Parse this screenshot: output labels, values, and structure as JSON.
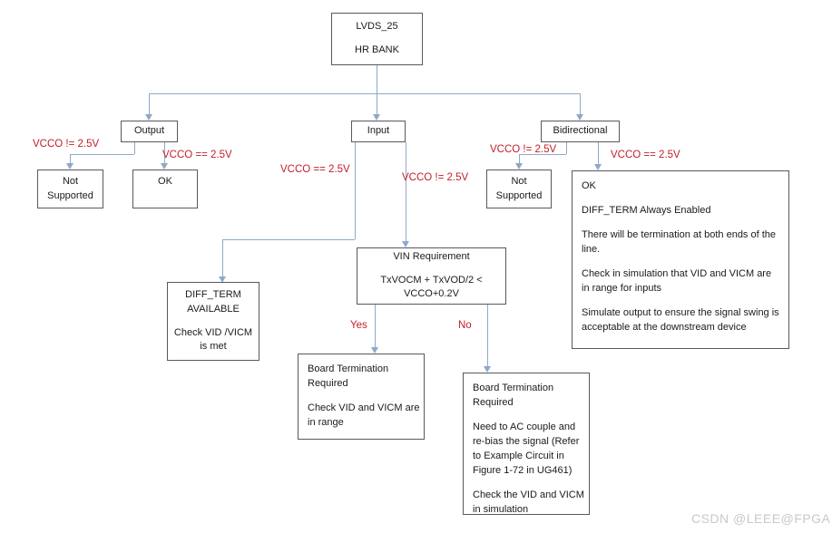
{
  "diagram": {
    "title": "LVDS_25 HR BANK termination decision flowchart",
    "colors": {
      "box_border": "#595959",
      "connector": "#8ea9c7",
      "edge_label": "#c0202a",
      "text": "#1a1a1a",
      "background": "#ffffff",
      "watermark": "#c9c9c9"
    },
    "nodes": {
      "root": {
        "line1": "LVDS_25",
        "line2": "HR BANK"
      },
      "output": {
        "label": "Output"
      },
      "input": {
        "label": "Input"
      },
      "bidirectional": {
        "label": "Bidirectional"
      },
      "output_not_supported": {
        "line1": "Not",
        "line2": "Supported"
      },
      "output_ok": {
        "label": "OK"
      },
      "bidir_not_supported": {
        "line1": "Not",
        "line2": "Supported"
      },
      "bidir_ok": {
        "p1": "OK",
        "p2": "DIFF_TERM  Always Enabled",
        "p3": "There will be termination at both ends of the line.",
        "p4": "Check in simulation that VID and VICM are in range for inputs",
        "p5": "Simulate output to ensure the signal swing is acceptable  at the downstream device"
      },
      "diff_term_available": {
        "line1": "DIFF_TERM",
        "line2": "AVAILABLE",
        "line3": "Check VID /VICM",
        "line4": "is met"
      },
      "vin_requirement": {
        "line1": "VIN Requirement",
        "line2": "TxVOCM + TxVOD/2 <",
        "line3": "VCCO+0.2V"
      },
      "board_term_yes": {
        "p1_line1": "Board Termination",
        "p1_line2": "Required",
        "p2_line1": "Check VID and VICM are",
        "p2_line2": "in range"
      },
      "board_term_no": {
        "p1_line1": "Board Termination",
        "p1_line2": "Required",
        "p2_line1": "Need to AC couple and",
        "p2_line2": "re-bias the signal (Refer",
        "p2_line3": "to Example Circuit in",
        "p2_line4": "Figure 1-72 in UG461)",
        "p3_line1": "Check the VID and VICM",
        "p3_line2": "in simulation"
      }
    },
    "edge_labels": {
      "output_not_supported": "VCCO != 2.5V",
      "output_ok": "VCCO == 2.5V",
      "input_diff_term": "VCCO == 2.5V",
      "input_vin": "VCCO != 2.5V",
      "bidir_not_supported": "VCCO != 2.5V",
      "bidir_ok": "VCCO == 2.5V",
      "vin_yes": "Yes",
      "vin_no": "No"
    },
    "watermark": "CSDN @LEEE@FPGA"
  }
}
